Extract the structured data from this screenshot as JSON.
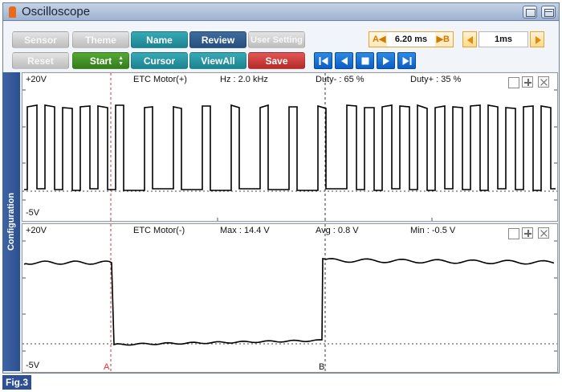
{
  "window": {
    "title": "Oscilloscope"
  },
  "toolbar": {
    "row1": [
      {
        "label": "Sensor",
        "style": "gray"
      },
      {
        "label": "Theme",
        "style": "gray"
      },
      {
        "label": "Name",
        "style": "teal"
      },
      {
        "label": "Review",
        "style": "blue"
      },
      {
        "label": "User Setting",
        "style": "gray"
      }
    ],
    "row2": [
      {
        "label": "Reset",
        "style": "gray"
      },
      {
        "label": "Start",
        "style": "green"
      },
      {
        "label": "Cursor",
        "style": "teal"
      },
      {
        "label": "ViewAll",
        "style": "teal"
      },
      {
        "label": "Save",
        "style": "red"
      }
    ],
    "cursor_a_label": "A",
    "cursor_b_label": "B",
    "cursor_delta": "6.20 ms",
    "time_per_div": "1ms"
  },
  "sidebar": {
    "label": "Configuration"
  },
  "channels": [
    {
      "top_scale": "+20V",
      "bottom_scale": "-5V",
      "name": "ETC Motor(+)",
      "stat1": "Hz : 2.0 kHz",
      "stat2": "Duty- : 65 %",
      "stat3": "Duty+ : 35 %"
    },
    {
      "top_scale": "+20V",
      "bottom_scale": "-5V",
      "name": "ETC Motor(-)",
      "stat1": "Max : 14.4 V",
      "stat2": "Avg : 0.8 V",
      "stat3": "Min : -0.5 V"
    }
  ],
  "cursors": {
    "a_marker": "A",
    "b_marker": "B"
  },
  "figure": {
    "label": "Fig.3"
  },
  "colors": {
    "trace": "#000000",
    "cursor_a": "#e03030",
    "cursor_b": "#333333",
    "sidebar": "#2c4f8e"
  }
}
